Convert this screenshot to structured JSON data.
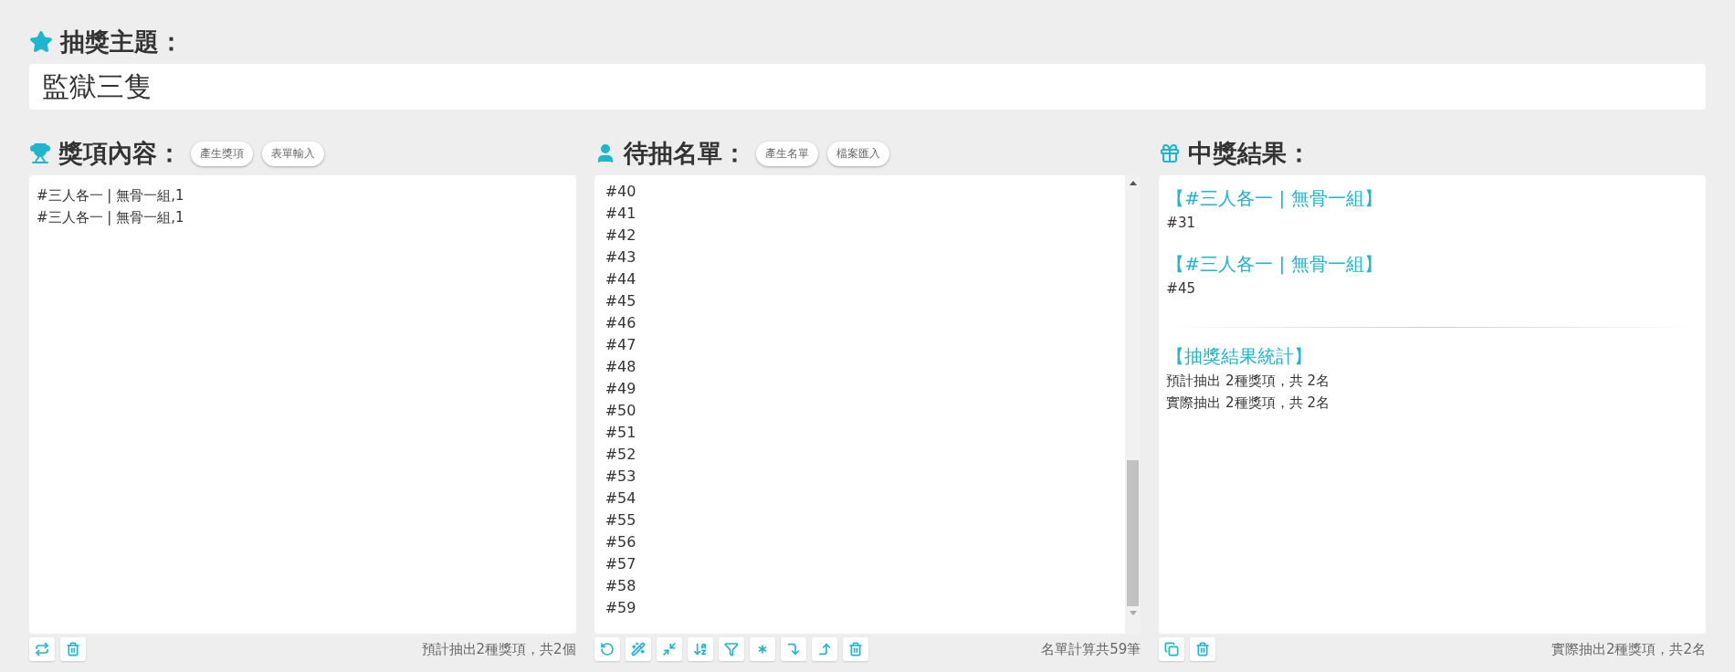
{
  "topic": {
    "label": "抽獎主題：",
    "value": "監獄三隻"
  },
  "prizes": {
    "label": "獎項內容：",
    "buttons": [
      "產生獎項",
      "表單輸入"
    ],
    "lines": [
      "#三人各一 | 無骨一組,1",
      "#三人各一 | 無骨一組,1"
    ],
    "tools": [
      {
        "kind": "repeat"
      },
      {
        "kind": "trash"
      }
    ],
    "summary": "預計抽出2種獎項，共2個"
  },
  "names": {
    "label": "待抽名單：",
    "buttons": [
      "產生名單",
      "檔案匯入"
    ],
    "lines": [
      "#40",
      "#41",
      "#42",
      "#43",
      "#44",
      "#45",
      "#46",
      "#47",
      "#48",
      "#49",
      "#50",
      "#51",
      "#52",
      "#53",
      "#54",
      "#55",
      "#56",
      "#57",
      "#58",
      "#59"
    ],
    "tools": [
      {
        "kind": "undo"
      },
      {
        "kind": "wand"
      },
      {
        "kind": "shrink"
      },
      {
        "kind": "sort"
      },
      {
        "kind": "filter"
      },
      {
        "kind": "asterisk"
      },
      {
        "kind": "down"
      },
      {
        "kind": "up"
      },
      {
        "kind": "trash"
      }
    ],
    "summary": "名單計算共59筆"
  },
  "results": {
    "label": "中獎結果：",
    "winners": [
      {
        "prize": "【#三人各一 | 無骨一組】",
        "name": "#31"
      },
      {
        "prize": "【#三人各一 | 無骨一組】",
        "name": "#45"
      }
    ],
    "stats_title": "【抽獎結果統計】",
    "stats": [
      "預計抽出 2種獎項，共 2名",
      "實際抽出 2種獎項，共 2名"
    ],
    "tools": [
      {
        "kind": "copy"
      },
      {
        "kind": "trash"
      }
    ],
    "summary": "實際抽出2種獎項，共2名"
  }
}
